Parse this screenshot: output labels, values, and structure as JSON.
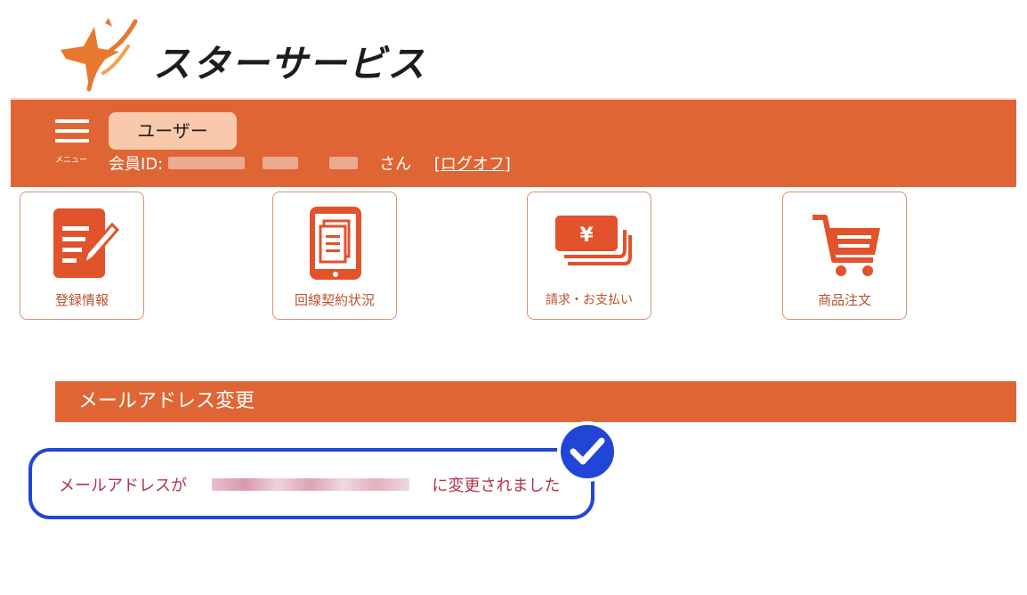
{
  "brand": {
    "name": "スターサービス",
    "logo_icon": "star-swoosh-logo"
  },
  "header": {
    "menu_label": "メニュー",
    "role_badge": "ユーザー",
    "member_prefix": "会員ID:",
    "member_suffix": "さん",
    "logoff_label": "[ログオフ]",
    "accent_color": "#e06535"
  },
  "tiles": [
    {
      "label": "登録情報",
      "icon": "edit-document-icon"
    },
    {
      "label": "回線契約状況",
      "icon": "tablet-documents-icon"
    },
    {
      "label": "請求・お支払い",
      "icon": "yen-bills-icon"
    },
    {
      "label": "商品注文",
      "icon": "shopping-cart-icon"
    }
  ],
  "section": {
    "title": "メールアドレス変更"
  },
  "notice": {
    "prefix": "メールアドレスが",
    "suffix": "に変更されました",
    "status_icon": "check-circle-icon",
    "status_color": "#2146d6"
  }
}
